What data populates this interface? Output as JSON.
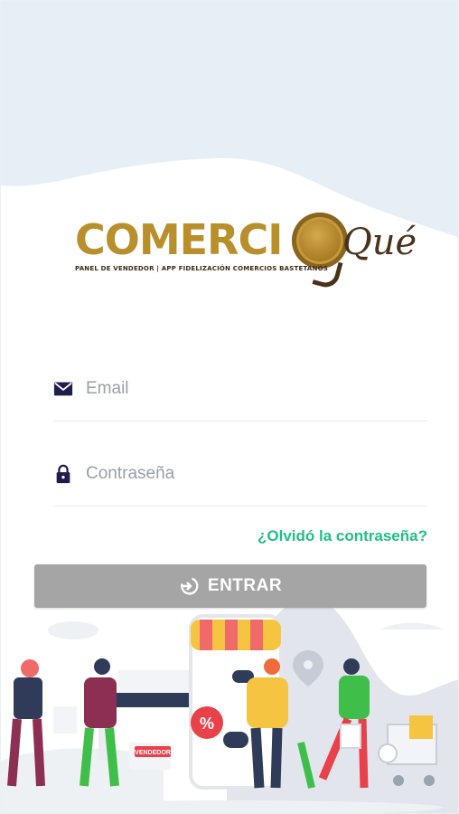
{
  "app": {
    "logo": {
      "wordmark": "COMERCI",
      "que": "Qué",
      "tagline": "PANEL DE VENDEDOR | APP FIDELIZACIÓN COMERCIOS BASTETANOS"
    }
  },
  "form": {
    "email": {
      "placeholder": "Email",
      "value": "",
      "icon": "envelope-icon"
    },
    "password": {
      "placeholder": "Contraseña",
      "value": "",
      "icon": "lock-icon"
    },
    "forgot_label": "¿Olvidó la contraseña?",
    "submit": {
      "label": "ENTRAR",
      "icon": "login-icon"
    }
  },
  "illustration": {
    "sale_badge": "%",
    "sign_text": "VENDEDOR"
  },
  "colors": {
    "accent": "#1fbf8a",
    "icon": "#1f1d4b",
    "button_disabled": "#a5a5a5",
    "logo_gold": "#b98f2c",
    "logo_brown": "#4a3218",
    "sky": "#e6eef6"
  }
}
